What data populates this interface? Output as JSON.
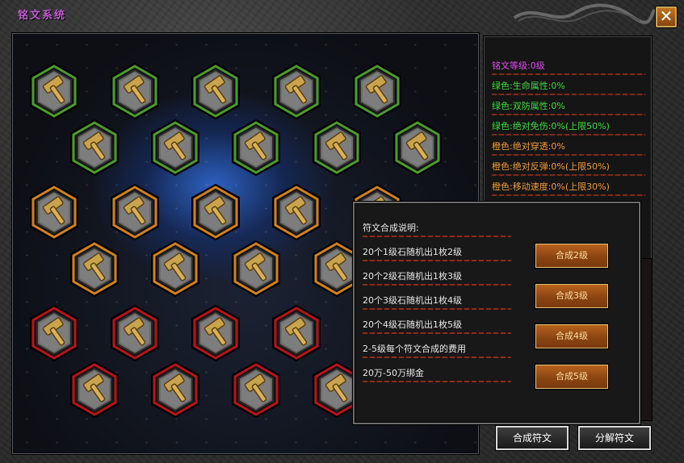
{
  "window": {
    "title": "铭文系统",
    "close_label": "✕"
  },
  "colors": {
    "green": "#4c9a2e",
    "orange": "#d0801f",
    "red": "#b8121a",
    "title": "#c45bd6"
  },
  "board": {
    "slots": [
      {
        "tier": "green"
      },
      {
        "tier": "green"
      },
      {
        "tier": "green"
      },
      {
        "tier": "green"
      },
      {
        "tier": "green"
      },
      {
        "tier": "green"
      },
      {
        "tier": "green"
      },
      {
        "tier": "green"
      },
      {
        "tier": "green"
      },
      {
        "tier": "green"
      },
      {
        "tier": "orange"
      },
      {
        "tier": "orange"
      },
      {
        "tier": "orange"
      },
      {
        "tier": "orange"
      },
      {
        "tier": "orange"
      },
      {
        "tier": "orange"
      },
      {
        "tier": "orange"
      },
      {
        "tier": "orange"
      },
      {
        "tier": "orange"
      },
      {
        "tier": "red"
      },
      {
        "tier": "red"
      },
      {
        "tier": "red"
      },
      {
        "tier": "red"
      },
      {
        "tier": "red"
      },
      {
        "tier": "red"
      },
      {
        "tier": "red"
      },
      {
        "tier": "red"
      }
    ],
    "slot_icon": "hammer-icon"
  },
  "stats": [
    {
      "text": "铭文等级:0级",
      "color": "purple"
    },
    {
      "text": "绿色:生命属性:0%",
      "color": "green"
    },
    {
      "text": "绿色:双防属性:0%",
      "color": "green"
    },
    {
      "text": "绿色:绝对免伤:0%(上限50%)",
      "color": "green"
    },
    {
      "text": "橙色:绝对穿透:0%",
      "color": "orange"
    },
    {
      "text": "橙色:绝对反弹:0%(上限50%)",
      "color": "orange"
    },
    {
      "text": "橙色:移动速度:0%(上限30%)",
      "color": "orange"
    }
  ],
  "popup": {
    "heading": "符文合成说明:",
    "lines": [
      "20个1级石随机出1枚2级",
      "20个2级石随机出1枚3级",
      "20个3级石随机出1枚4级",
      "20个4级石随机出1枚5级",
      "2-5级每个符文合成的费用",
      "20万-50万绑金"
    ],
    "buttons": [
      "合成2级",
      "合成3级",
      "合成4级",
      "合成5级"
    ]
  },
  "footer": {
    "compose_label": "合成符文",
    "decompose_label": "分解符文"
  }
}
